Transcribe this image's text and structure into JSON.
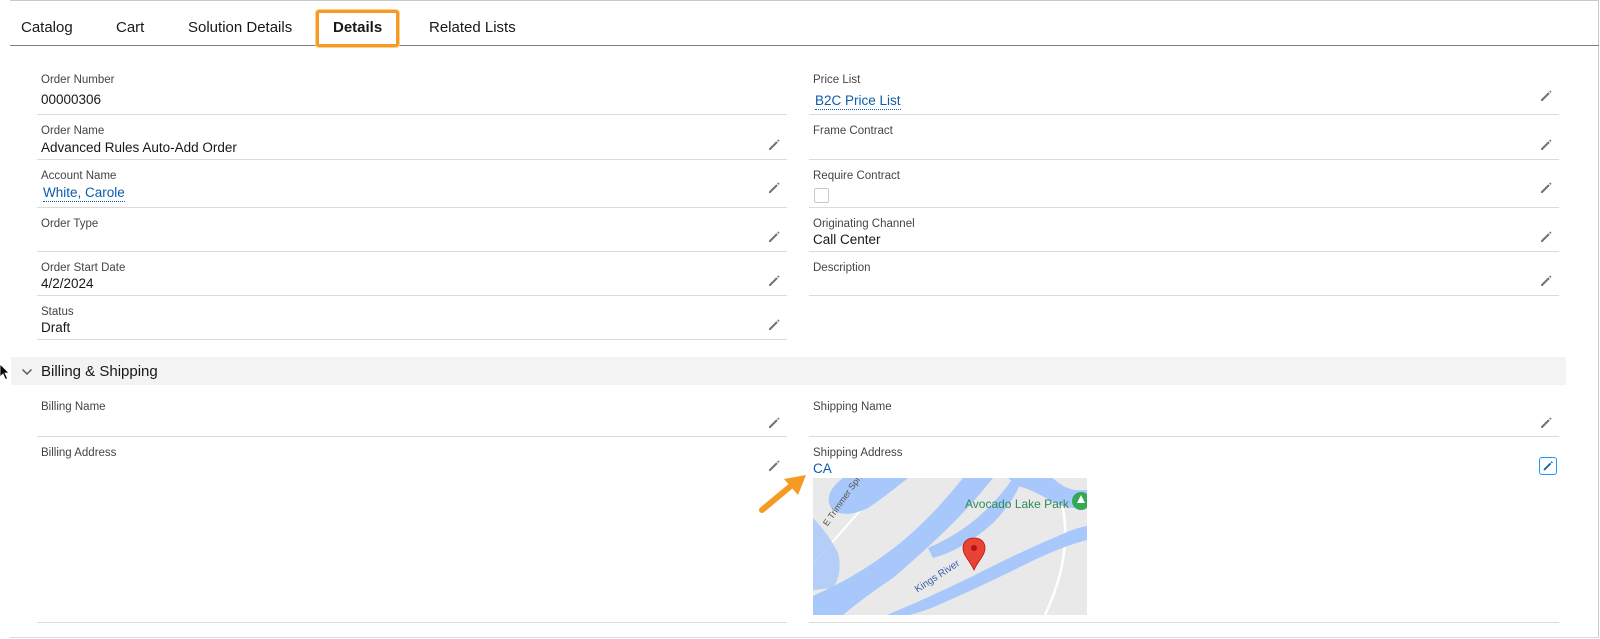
{
  "tabs": [
    {
      "label": "Catalog"
    },
    {
      "label": "Cart"
    },
    {
      "label": "Solution Details"
    },
    {
      "label": "Details"
    },
    {
      "label": "Related Lists"
    }
  ],
  "fields_left": {
    "order_number": {
      "label": "Order Number",
      "value": "00000306"
    },
    "order_name": {
      "label": "Order Name",
      "value": "Advanced Rules Auto-Add Order"
    },
    "account_name": {
      "label": "Account Name",
      "value": "White, Carole"
    },
    "order_type": {
      "label": "Order Type",
      "value": ""
    },
    "order_start_date": {
      "label": "Order Start Date",
      "value": "4/2/2024"
    },
    "status": {
      "label": "Status",
      "value": "Draft"
    }
  },
  "fields_right": {
    "price_list": {
      "label": "Price List",
      "value": "B2C Price List"
    },
    "frame_contract": {
      "label": "Frame Contract",
      "value": ""
    },
    "require_contract": {
      "label": "Require Contract",
      "value": ""
    },
    "originating_channel": {
      "label": "Originating Channel",
      "value": "Call Center"
    },
    "description": {
      "label": "Description",
      "value": ""
    }
  },
  "billing_shipping": {
    "section_title": "Billing & Shipping",
    "billing_name": {
      "label": "Billing Name",
      "value": ""
    },
    "billing_address": {
      "label": "Billing Address",
      "value": ""
    },
    "shipping_name": {
      "label": "Shipping Name",
      "value": ""
    },
    "shipping_address": {
      "label": "Shipping Address",
      "value": "CA"
    }
  },
  "map": {
    "place_label": "Avocado Lake Park",
    "street_label": "E Trimmer Springs R",
    "river_label": "Kings River"
  },
  "colors": {
    "link": "#0b5cab",
    "highlight": "#f59a23",
    "water": "#a8c7fa",
    "pin": "#ea4335"
  }
}
